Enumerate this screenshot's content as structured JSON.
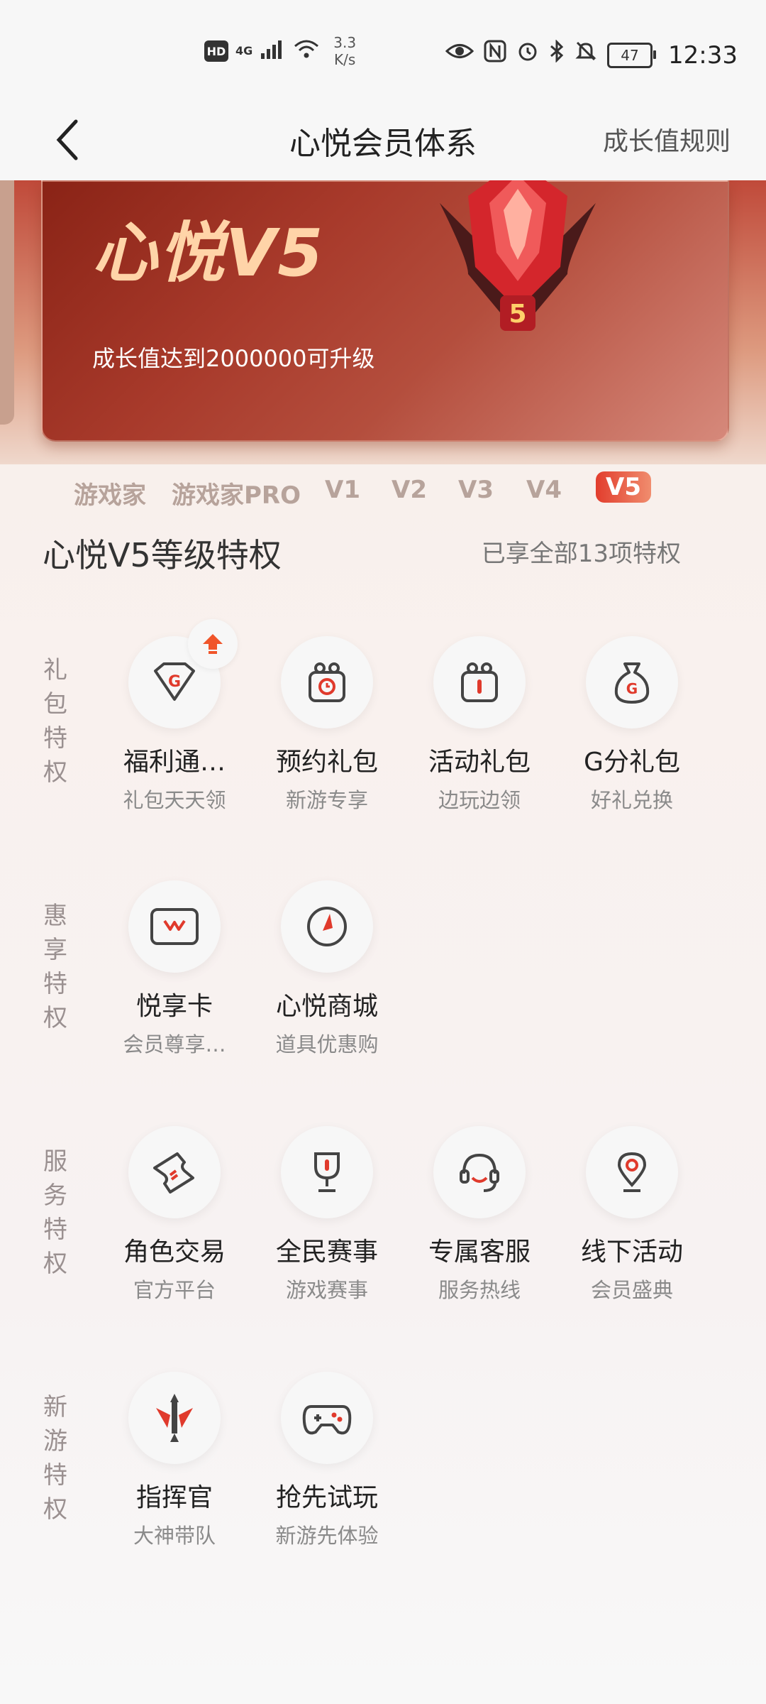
{
  "status_bar": {
    "hd": "HD",
    "network": "4G",
    "speed_value": "3.3",
    "speed_unit": "K/s",
    "battery": "47",
    "time": "12:33",
    "icons": [
      "eye-icon",
      "nfc-icon",
      "alarm-icon",
      "bluetooth-icon",
      "mute-icon"
    ]
  },
  "nav": {
    "title": "心悦会员体系",
    "right_link": "成长值规则"
  },
  "banner": {
    "level_title": "心悦V5",
    "description": "成长值达到2000000可升级",
    "emblem_number": "5"
  },
  "level_tabs": [
    "游戏家",
    "游戏家PRO",
    "V1",
    "V2",
    "V3",
    "V4",
    "V5"
  ],
  "active_tab": "V5",
  "privileges": {
    "title": "心悦V5等级特权",
    "summary": "已享全部13项特权",
    "categories": [
      {
        "label": [
          "礼",
          "包",
          "特",
          "权"
        ],
        "items": [
          {
            "name": "福利通…",
            "sub": "礼包天天领",
            "icon": "gift-diamond-icon"
          },
          {
            "name": "预约礼包",
            "sub": "新游专享",
            "icon": "reserve-gift-icon"
          },
          {
            "name": "活动礼包",
            "sub": "边玩边领",
            "icon": "event-gift-icon"
          },
          {
            "name": "G分礼包",
            "sub": "好礼兑换",
            "icon": "money-bag-icon"
          }
        ]
      },
      {
        "label": [
          "惠",
          "享",
          "特",
          "权"
        ],
        "items": [
          {
            "name": "悦享卡",
            "sub": "会员尊享…",
            "icon": "card-icon"
          },
          {
            "name": "心悦商城",
            "sub": "道具优惠购",
            "icon": "compass-icon"
          }
        ]
      },
      {
        "label": [
          "服",
          "务",
          "特",
          "权"
        ],
        "items": [
          {
            "name": "角色交易",
            "sub": "官方平台",
            "icon": "ticket-icon"
          },
          {
            "name": "全民赛事",
            "sub": "游戏赛事",
            "icon": "trophy-icon"
          },
          {
            "name": "专属客服",
            "sub": "服务热线",
            "icon": "headset-icon"
          },
          {
            "name": "线下活动",
            "sub": "会员盛典",
            "icon": "location-icon"
          }
        ]
      },
      {
        "label": [
          "新",
          "游",
          "特",
          "权"
        ],
        "items": [
          {
            "name": "指挥官",
            "sub": "大神带队",
            "icon": "sword-icon"
          },
          {
            "name": "抢先试玩",
            "sub": "新游先体验",
            "icon": "gamepad-icon"
          }
        ]
      }
    ]
  },
  "colors": {
    "accent": "#e03a2c",
    "gold_text": "#ffd4a8",
    "icon_stroke": "#555555"
  }
}
